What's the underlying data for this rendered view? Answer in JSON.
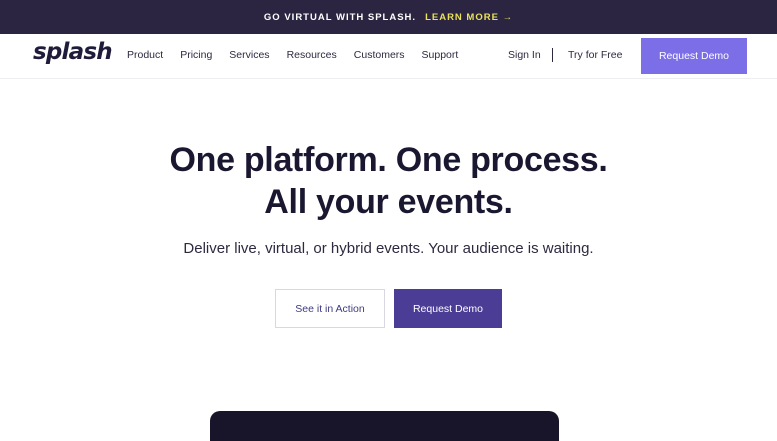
{
  "banner": {
    "text": "GO VIRTUAL WITH SPLASH.",
    "link": "LEARN MORE →"
  },
  "nav": {
    "logo": "splash",
    "items": [
      "Product",
      "Pricing",
      "Services",
      "Resources",
      "Customers",
      "Support"
    ],
    "sign_in": "Sign In",
    "try_free": "Try for Free",
    "demo": "Request Demo"
  },
  "hero": {
    "title_line1": "One platform. One process.",
    "title_line2": "All your events.",
    "subtitle": "Deliver live, virtual, or hybrid events. Your audience is waiting.",
    "secondary_cta": "See it in Action",
    "primary_cta": "Request Demo"
  },
  "colors": {
    "banner_bg": "#2b2541",
    "banner_link": "#e9e25a",
    "nav_demo_bg": "#7b6ee6",
    "primary_cta_bg": "#4b3c96"
  }
}
